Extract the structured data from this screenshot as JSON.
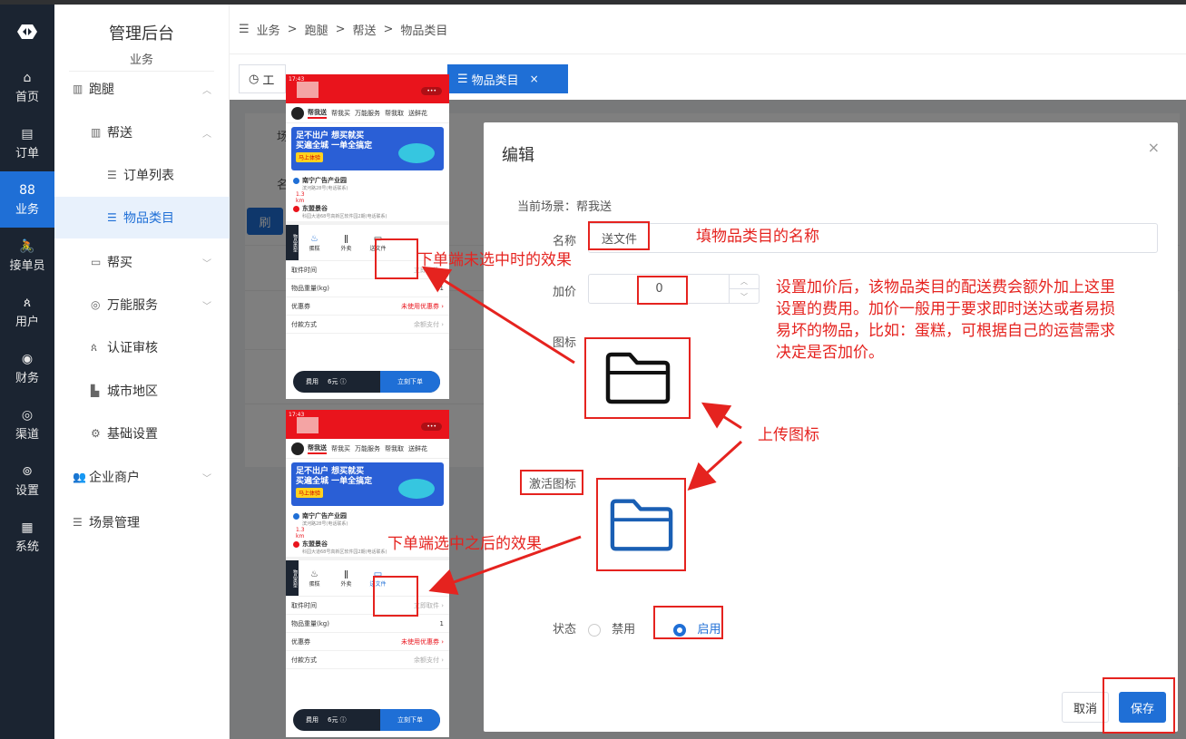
{
  "nav": {
    "items": [
      {
        "icon": "⌂",
        "label": "首页"
      },
      {
        "icon": "▤",
        "label": "订单"
      },
      {
        "icon": "88",
        "label": "业务"
      },
      {
        "icon": "🚴",
        "label": "接单员"
      },
      {
        "icon": "ጰ",
        "label": "用户"
      },
      {
        "icon": "◉",
        "label": "财务"
      },
      {
        "icon": "◎",
        "label": "渠道"
      },
      {
        "icon": "⊚",
        "label": "设置"
      },
      {
        "icon": "▦",
        "label": "系统"
      }
    ]
  },
  "menu": {
    "title": "管理后台",
    "subtitle": "业务",
    "items": {
      "paotui": "跑腿",
      "bangsong": "帮送",
      "order_list": "订单列表",
      "item_category": "物品类目",
      "bangmai": "帮买",
      "wanneng": "万能服务",
      "renzheng": "认证审核",
      "city": "城市地区",
      "basic": "基础设置",
      "enterprise": "企业商户",
      "scene": "场景管理"
    }
  },
  "header": {
    "breadcrumb": [
      "业务",
      "跑腿",
      "帮送",
      "物品类目"
    ],
    "sep": ">",
    "toggle_icon": "☰"
  },
  "tabs": {
    "tab1": "工",
    "active": "物品类目",
    "close": "×"
  },
  "bg_form": {
    "label1": "场",
    "label2": "名",
    "btn": "刷"
  },
  "dialog": {
    "title": "编辑",
    "close": "×",
    "scene": "当前场景：帮我送",
    "name_label": "名称",
    "name_value": "送文件",
    "price_label": "加价",
    "price_value": "0",
    "icon_label": "图标",
    "active_icon_label": "激活图标",
    "status_label": "状态",
    "status_off": "禁用",
    "status_on": "启用",
    "cancel": "取消",
    "save": "保存",
    "colors": {
      "accent": "#1f6fd6",
      "annotation": "#e5231f",
      "active_icon": "#1a5fb4"
    }
  },
  "annotations": {
    "name_hint": "填物品类目的名称",
    "price_hint_l1": "设置加价后，该物品类目的配送费会额外加上这里",
    "price_hint_l2": "设置的费用。加价一般用于要求即时送达或者易损",
    "price_hint_l3": "易坏的物品，比如：蛋糕，可根据自己的运营需求",
    "price_hint_l4": "决定是否加价。",
    "upload_icon": "上传图标",
    "unselected_effect": "下单端未选中时的效果",
    "selected_effect": "下单端选中之后的效果"
  },
  "phone": {
    "time": "17:43",
    "signal": "▮▮ ⊗",
    "menu_dots": "•••",
    "tabs": [
      "帮我送",
      "帮我买",
      "万能服务",
      "帮我取",
      "送鲜花"
    ],
    "banner_l1": "足不出户 想买就买",
    "banner_l2": "买遍全城 一单全搞定",
    "banner_btn": "马上体验",
    "addr_from": "南宁广告产业园",
    "addr_from_sub": "滨河路28号(电话联系)",
    "distance": "1.3",
    "distance_unit": "km",
    "addr_to": "东盟景谷",
    "addr_to_sub": "科园大道68号高新区软件园2期(电话联系)",
    "side_label": "物品类型",
    "cats": [
      "蛋糕",
      "外卖",
      "送文件"
    ],
    "rows": [
      {
        "label": "取件时间",
        "value": "立即取件 ›"
      },
      {
        "label": "物品重量(kg)",
        "value": "1"
      },
      {
        "label": "优惠券",
        "value": "未使用优惠券 ›"
      },
      {
        "label": "付款方式",
        "value": "余额支付 ›"
      }
    ],
    "fee_label": "费用",
    "fee_value": "6元 ⓘ",
    "order_btn": "立刻下单"
  }
}
